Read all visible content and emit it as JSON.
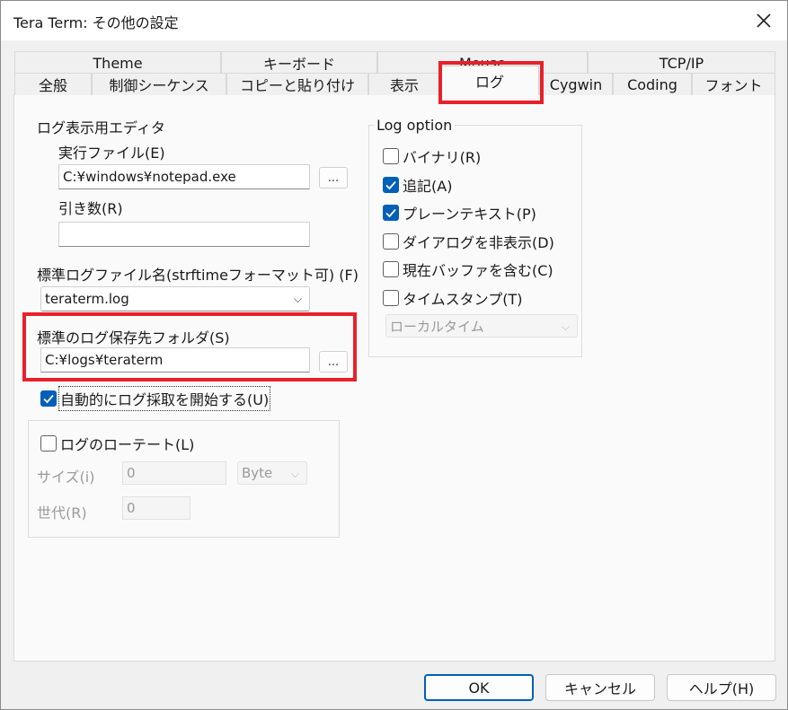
{
  "window": {
    "title": "Tera Term: その他の設定"
  },
  "tabs_back": [
    "Theme",
    "キーボード",
    "Mouse",
    "TCP/IP"
  ],
  "tabs_front": [
    "全般",
    "制御シーケンス",
    "コピーと貼り付け",
    "表示",
    "ログ",
    "Cygwin",
    "Coding",
    "フォント"
  ],
  "left": {
    "editor_group": "ログ表示用エディタ",
    "exec_label": "実行ファイル(E)",
    "exec_value": "C:¥windows¥notepad.exe",
    "browse": "...",
    "args_label": "引き数(R)",
    "args_value": "",
    "logname_label": "標準ログファイル名(strftimeフォーマット可) (F)",
    "logname_value": "teraterm.log",
    "folder_label": "標準のログ保存先フォルダ(S)",
    "folder_value": "C:¥logs¥teraterm",
    "auto_log_label": "自動的にログ採取を開始する(U)",
    "auto_log_checked": true,
    "rotate_label": "ログのローテート(L)",
    "rotate_checked": false,
    "size_label": "サイズ(i)",
    "size_value": "0",
    "size_unit": "Byte",
    "gen_label": "世代(R)",
    "gen_value": "0"
  },
  "log_option": {
    "title": "Log option",
    "items": [
      {
        "label": "バイナリ(R)",
        "checked": false
      },
      {
        "label": "追記(A)",
        "checked": true
      },
      {
        "label": "プレーンテキスト(P)",
        "checked": true
      },
      {
        "label": "ダイアログを非表示(D)",
        "checked": false
      },
      {
        "label": "現在バッファを含む(C)",
        "checked": false
      },
      {
        "label": "タイムスタンプ(T)",
        "checked": false
      }
    ],
    "timestamp_select": "ローカルタイム"
  },
  "footer": {
    "ok": "OK",
    "cancel": "キャンセル",
    "help": "ヘルプ(H)"
  },
  "colors": {
    "highlight": "#e8202a",
    "accent": "#005fb8"
  }
}
